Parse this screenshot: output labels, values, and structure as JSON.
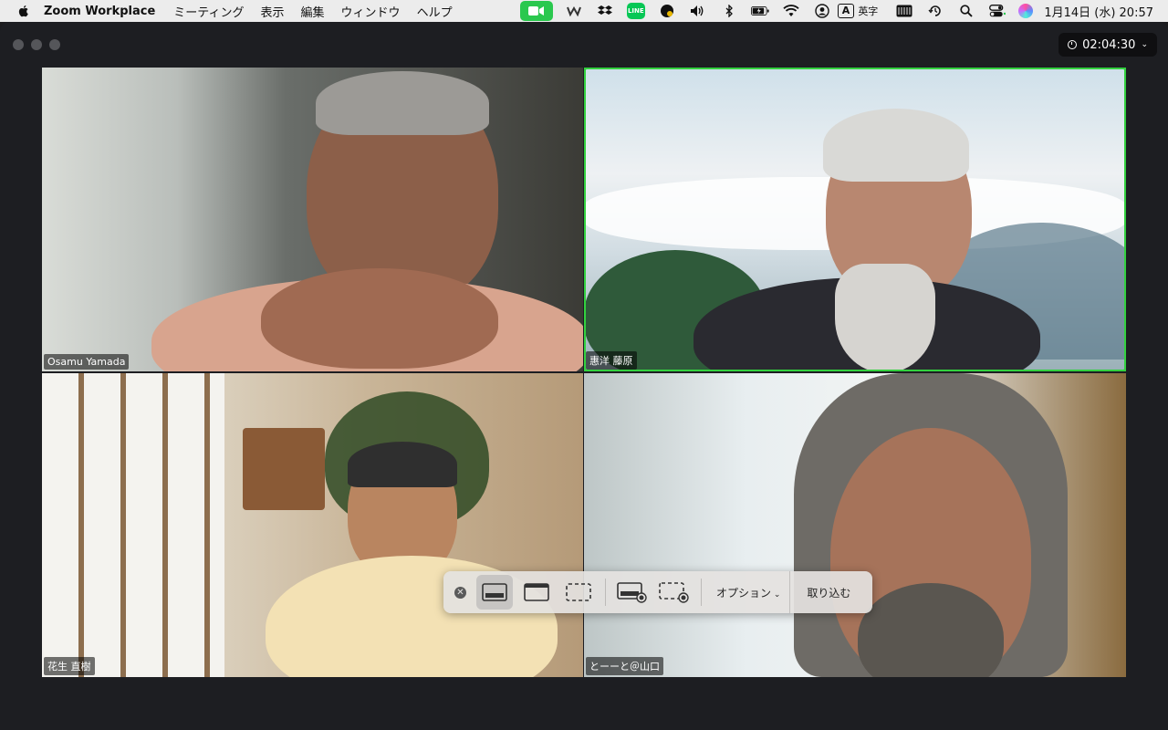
{
  "menubar": {
    "app_name": "Zoom Workplace",
    "menus": [
      "ミーティング",
      "表示",
      "編集",
      "ウィンドウ",
      "ヘルプ"
    ],
    "status_icons": [
      "zoom-meeting-icon",
      "webex-icon",
      "dropbox-icon",
      "line-icon",
      "evernote-icon",
      "volume-icon",
      "bluetooth-icon",
      "battery-icon",
      "wifi-icon",
      "user-icon",
      "keyboard-input-icon",
      "calendar-icon",
      "time-machine-icon",
      "search-icon",
      "control-center-icon",
      "siri-icon"
    ],
    "input_source_badge": "A",
    "input_source_label": "英字",
    "line_badge": "LINE",
    "clock": "1月14日 (水)  20:57"
  },
  "meeting": {
    "timer": "02:04:30",
    "participants": [
      {
        "name": "Osamu Yamada",
        "active": false
      },
      {
        "name": "惠洋 藤原",
        "active": true
      },
      {
        "name": "花生 直樹",
        "active": false
      },
      {
        "name": "とーーと＠山口",
        "active": false
      }
    ],
    "active_color": "#33d13f"
  },
  "capture_toolbar": {
    "options_label": "オプション",
    "capture_label": "取り込む"
  }
}
